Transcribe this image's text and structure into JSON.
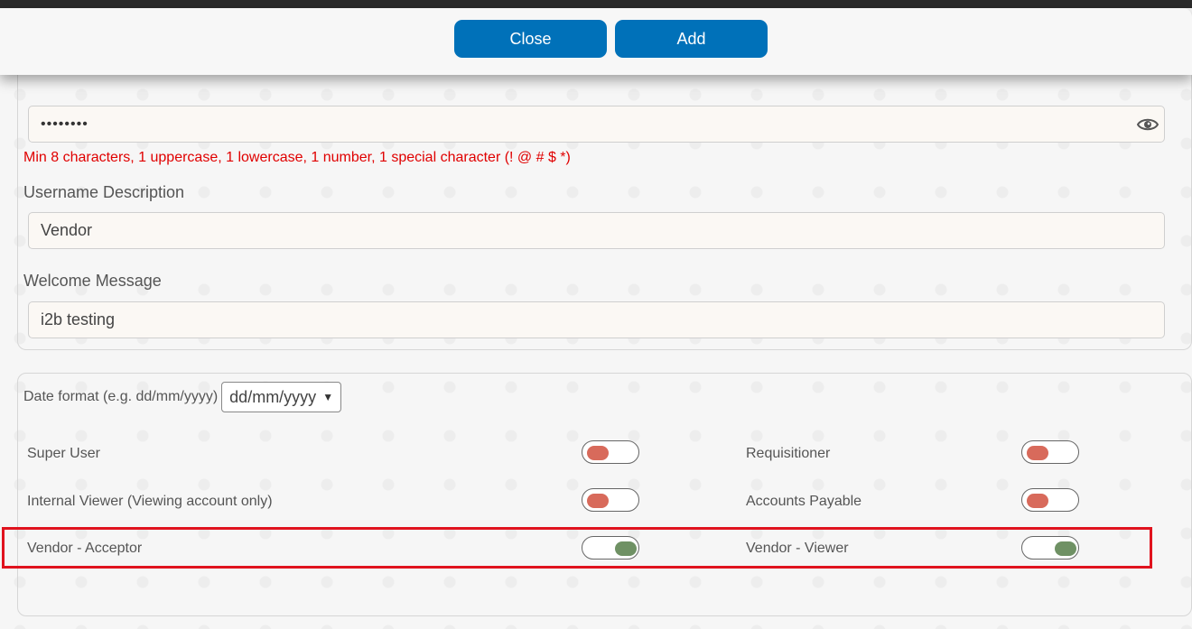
{
  "header": {
    "close_label": "Close",
    "add_label": "Add"
  },
  "form": {
    "password_value": "••••••••",
    "password_hint": "Min 8 characters, 1 uppercase, 1 lowercase, 1 number, 1 special character (! @ # $ *)",
    "username_description_label": "Username Description",
    "username_description_value": "Vendor",
    "welcome_message_label": "Welcome Message",
    "welcome_message_value": "i2b testing"
  },
  "settings": {
    "date_format_label": "Date format (e.g. dd/mm/yyyy)",
    "date_format_value": "dd/mm/yyyy",
    "permissions": [
      {
        "label": "Super User",
        "enabled": false
      },
      {
        "label": "Requisitioner",
        "enabled": false
      },
      {
        "label": "Internal Viewer (Viewing account only)",
        "enabled": false
      },
      {
        "label": "Accounts Payable",
        "enabled": false
      },
      {
        "label": "Vendor - Acceptor",
        "enabled": true
      },
      {
        "label": "Vendor - Viewer",
        "enabled": true
      }
    ]
  },
  "colors": {
    "button": "#0071b9",
    "toggle_off": "#d86a5b",
    "toggle_on": "#6f9164",
    "hint_text": "#e00000",
    "highlight": "#e0131e"
  }
}
